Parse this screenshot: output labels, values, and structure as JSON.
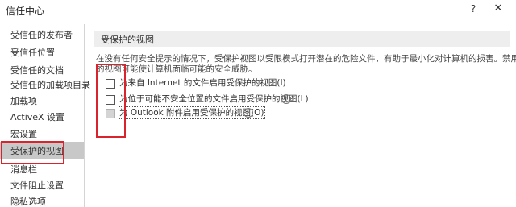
{
  "window": {
    "title": "信任中心",
    "help_label": "?",
    "close_label": "✕"
  },
  "sidebar": {
    "items": [
      {
        "label": "受信任的发布者"
      },
      {
        "label": "受信任位置"
      },
      {
        "label": "受信任的文档"
      },
      {
        "label": "受信任的加载项目录"
      },
      {
        "label": "加载项"
      },
      {
        "label": "ActiveX 设置"
      },
      {
        "label": "宏设置"
      },
      {
        "label": "受保护的视图",
        "selected": true
      },
      {
        "label": "消息栏"
      },
      {
        "label": "文件阻止设置"
      },
      {
        "label": "隐私选项"
      }
    ]
  },
  "main": {
    "section_title": "受保护的视图",
    "description_lines": [
      "在没有任何安全提示的情况下，受保护视图以受限模式打开潜在的危险文件，有助于最小化对计算机的损害。禁用受保护",
      "的视图可能使计算机面临可能的安全威胁。"
    ],
    "options": [
      {
        "label": "为来自 Internet 的文件启用受保护的视图(I)",
        "checked": false,
        "info": false,
        "disabled": false
      },
      {
        "label": "为位于可能不安全位置的文件启用受保护的视图(L)",
        "checked": false,
        "info": true,
        "disabled": false
      },
      {
        "label": "为 Outlook 附件启用受保护的视图(O)",
        "checked": false,
        "info": true,
        "disabled": true
      }
    ],
    "info_icon_glyph": "i"
  },
  "colors": {
    "annotation": "#d9232d",
    "selected_bg": "#c8c8c8",
    "header_bg": "#eeeeee"
  }
}
